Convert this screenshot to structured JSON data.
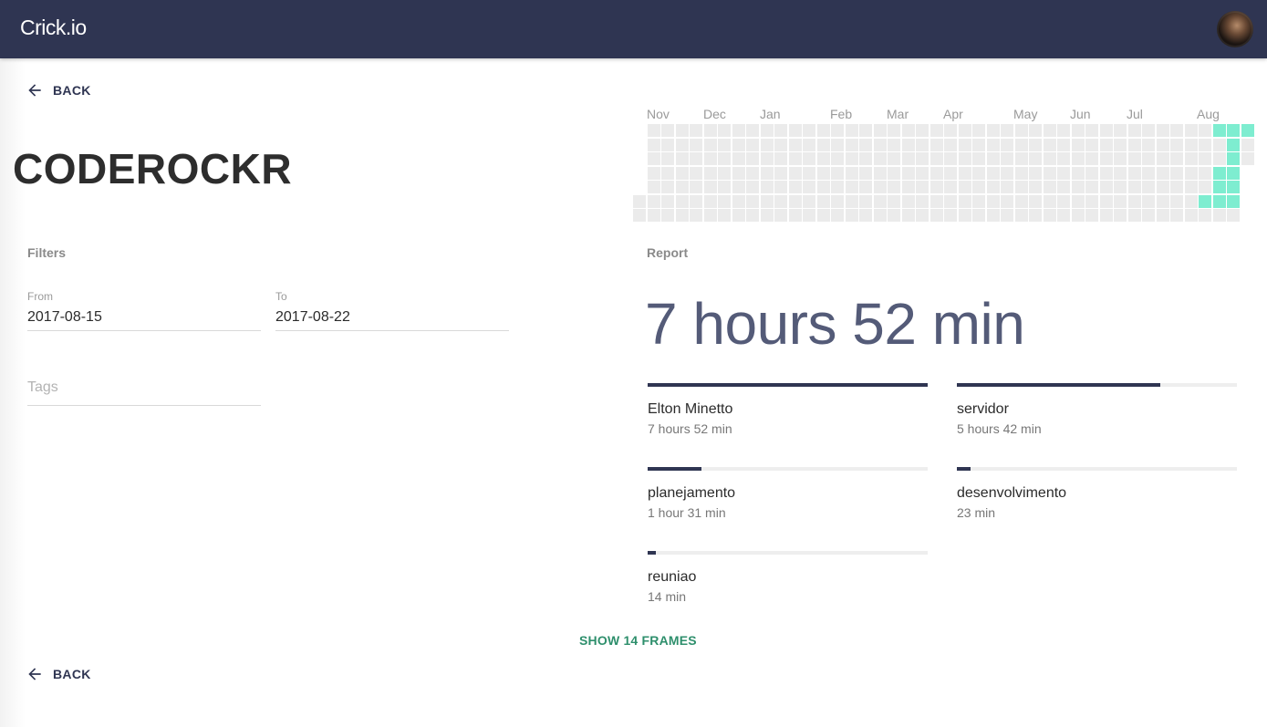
{
  "app": {
    "brand": "Crick.io"
  },
  "nav": {
    "back_label": "BACK"
  },
  "project": {
    "title": "CODEROCKR"
  },
  "filters": {
    "label": "Filters",
    "from": {
      "label": "From",
      "value": "2017-08-15"
    },
    "to": {
      "label": "To",
      "value": "2017-08-22"
    },
    "tags": {
      "placeholder": "Tags"
    }
  },
  "heatmap": {
    "months": [
      "Nov",
      "Dec",
      "Jan",
      "Feb",
      "Mar",
      "Apr",
      "May",
      "Jun",
      "Jul",
      "Aug"
    ],
    "active_color": "#7eedd0",
    "inactive_color": "#ebebeb"
  },
  "report": {
    "label": "Report",
    "total": "7 hours 52 min",
    "items": [
      {
        "name": "Elton Minetto",
        "time": "7 hours 52 min",
        "fraction": 1.0
      },
      {
        "name": "servidor",
        "time": "5 hours 42 min",
        "fraction": 0.725
      },
      {
        "name": "planejamento",
        "time": "1 hour 31 min",
        "fraction": 0.193
      },
      {
        "name": "desenvolvimento",
        "time": "23 min",
        "fraction": 0.049
      },
      {
        "name": "reuniao",
        "time": "14 min",
        "fraction": 0.03
      }
    ]
  },
  "frames": {
    "show_label": "SHOW 14 FRAMES"
  },
  "colors": {
    "topbar": "#2f3552",
    "accent": "#2e8f6c",
    "bar": "#2f3552",
    "total_text": "#545b78"
  }
}
